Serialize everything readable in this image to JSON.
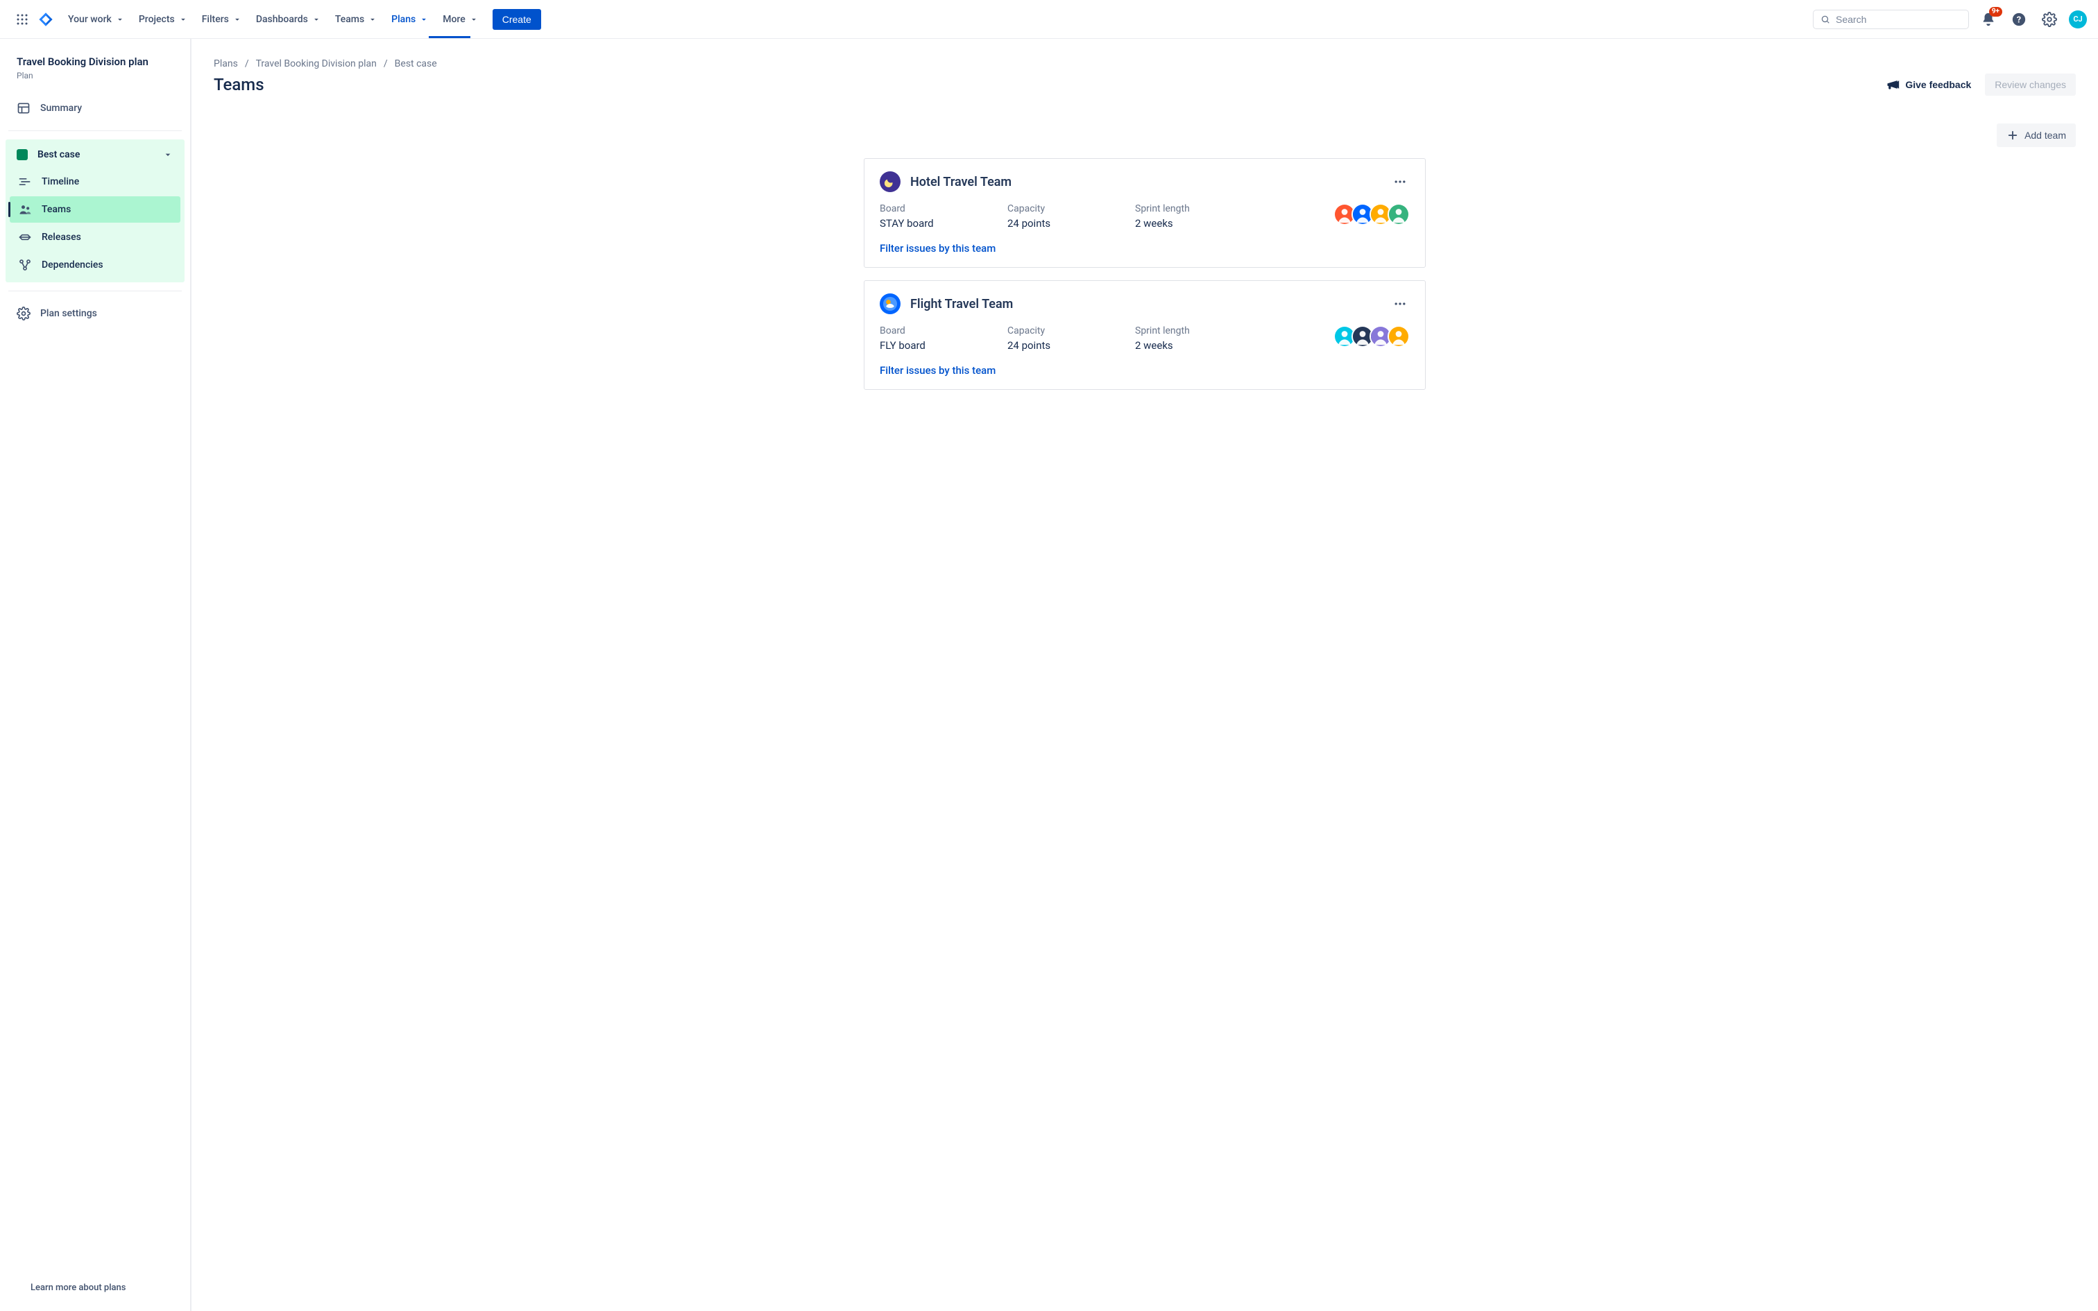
{
  "topnav": {
    "items": [
      {
        "label": "Your work"
      },
      {
        "label": "Projects"
      },
      {
        "label": "Filters"
      },
      {
        "label": "Dashboards"
      },
      {
        "label": "Teams"
      },
      {
        "label": "Plans"
      },
      {
        "label": "More"
      }
    ],
    "create_label": "Create",
    "search_placeholder": "Search",
    "notification_badge": "9+",
    "user_initials": "CJ"
  },
  "sidebar": {
    "plan_title": "Travel Booking Division plan",
    "plan_subtitle": "Plan",
    "summary_label": "Summary",
    "scenario": {
      "name": "Best case",
      "items": [
        {
          "label": "Timeline"
        },
        {
          "label": "Teams"
        },
        {
          "label": "Releases"
        },
        {
          "label": "Dependencies"
        }
      ]
    },
    "settings_label": "Plan settings",
    "learn_label": "Learn more about plans"
  },
  "breadcrumbs": [
    "Plans",
    "Travel Booking Division plan",
    "Best case"
  ],
  "page": {
    "title": "Teams",
    "feedback_label": "Give feedback",
    "review_label": "Review changes",
    "add_team_label": "Add team"
  },
  "labels": {
    "board": "Board",
    "capacity": "Capacity",
    "sprint_length": "Sprint length",
    "filter": "Filter issues by this team"
  },
  "teams": [
    {
      "name": "Hotel Travel Team",
      "avatar_style": "hotel",
      "board": "STAY board",
      "capacity": "24 points",
      "sprint_length": "2 weeks",
      "members": [
        {
          "bg": "#FF5630"
        },
        {
          "bg": "#0065FF"
        },
        {
          "bg": "#FFAB00"
        },
        {
          "bg": "#36B37E"
        }
      ]
    },
    {
      "name": "Flight Travel Team",
      "avatar_style": "flight",
      "board": "FLY board",
      "capacity": "24 points",
      "sprint_length": "2 weeks",
      "members": [
        {
          "bg": "#00C7E6"
        },
        {
          "bg": "#253858"
        },
        {
          "bg": "#8777D9"
        },
        {
          "bg": "#FFAB00"
        }
      ]
    }
  ]
}
